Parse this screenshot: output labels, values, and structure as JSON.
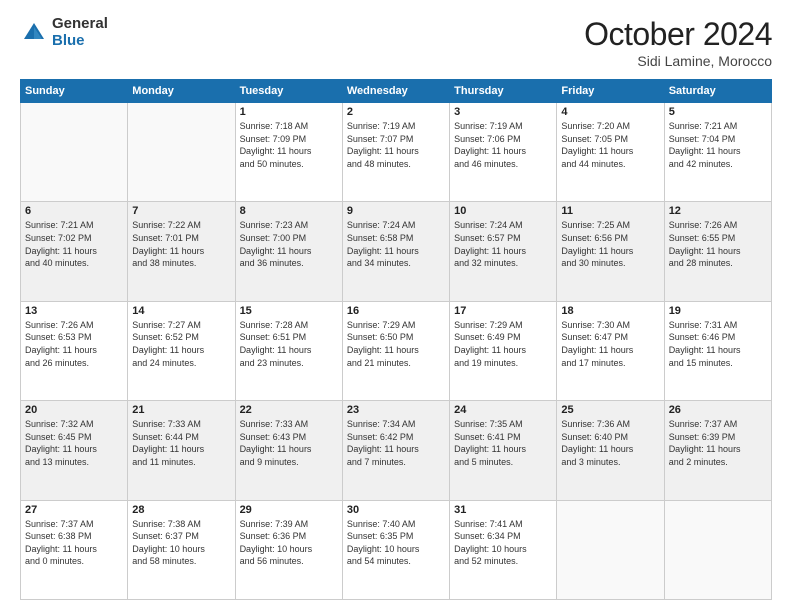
{
  "logo": {
    "general": "General",
    "blue": "Blue"
  },
  "title": {
    "month": "October 2024",
    "location": "Sidi Lamine, Morocco"
  },
  "headers": [
    "Sunday",
    "Monday",
    "Tuesday",
    "Wednesday",
    "Thursday",
    "Friday",
    "Saturday"
  ],
  "weeks": [
    [
      {
        "day": "",
        "info": ""
      },
      {
        "day": "",
        "info": ""
      },
      {
        "day": "1",
        "info": "Sunrise: 7:18 AM\nSunset: 7:09 PM\nDaylight: 11 hours\nand 50 minutes."
      },
      {
        "day": "2",
        "info": "Sunrise: 7:19 AM\nSunset: 7:07 PM\nDaylight: 11 hours\nand 48 minutes."
      },
      {
        "day": "3",
        "info": "Sunrise: 7:19 AM\nSunset: 7:06 PM\nDaylight: 11 hours\nand 46 minutes."
      },
      {
        "day": "4",
        "info": "Sunrise: 7:20 AM\nSunset: 7:05 PM\nDaylight: 11 hours\nand 44 minutes."
      },
      {
        "day": "5",
        "info": "Sunrise: 7:21 AM\nSunset: 7:04 PM\nDaylight: 11 hours\nand 42 minutes."
      }
    ],
    [
      {
        "day": "6",
        "info": "Sunrise: 7:21 AM\nSunset: 7:02 PM\nDaylight: 11 hours\nand 40 minutes."
      },
      {
        "day": "7",
        "info": "Sunrise: 7:22 AM\nSunset: 7:01 PM\nDaylight: 11 hours\nand 38 minutes."
      },
      {
        "day": "8",
        "info": "Sunrise: 7:23 AM\nSunset: 7:00 PM\nDaylight: 11 hours\nand 36 minutes."
      },
      {
        "day": "9",
        "info": "Sunrise: 7:24 AM\nSunset: 6:58 PM\nDaylight: 11 hours\nand 34 minutes."
      },
      {
        "day": "10",
        "info": "Sunrise: 7:24 AM\nSunset: 6:57 PM\nDaylight: 11 hours\nand 32 minutes."
      },
      {
        "day": "11",
        "info": "Sunrise: 7:25 AM\nSunset: 6:56 PM\nDaylight: 11 hours\nand 30 minutes."
      },
      {
        "day": "12",
        "info": "Sunrise: 7:26 AM\nSunset: 6:55 PM\nDaylight: 11 hours\nand 28 minutes."
      }
    ],
    [
      {
        "day": "13",
        "info": "Sunrise: 7:26 AM\nSunset: 6:53 PM\nDaylight: 11 hours\nand 26 minutes."
      },
      {
        "day": "14",
        "info": "Sunrise: 7:27 AM\nSunset: 6:52 PM\nDaylight: 11 hours\nand 24 minutes."
      },
      {
        "day": "15",
        "info": "Sunrise: 7:28 AM\nSunset: 6:51 PM\nDaylight: 11 hours\nand 23 minutes."
      },
      {
        "day": "16",
        "info": "Sunrise: 7:29 AM\nSunset: 6:50 PM\nDaylight: 11 hours\nand 21 minutes."
      },
      {
        "day": "17",
        "info": "Sunrise: 7:29 AM\nSunset: 6:49 PM\nDaylight: 11 hours\nand 19 minutes."
      },
      {
        "day": "18",
        "info": "Sunrise: 7:30 AM\nSunset: 6:47 PM\nDaylight: 11 hours\nand 17 minutes."
      },
      {
        "day": "19",
        "info": "Sunrise: 7:31 AM\nSunset: 6:46 PM\nDaylight: 11 hours\nand 15 minutes."
      }
    ],
    [
      {
        "day": "20",
        "info": "Sunrise: 7:32 AM\nSunset: 6:45 PM\nDaylight: 11 hours\nand 13 minutes."
      },
      {
        "day": "21",
        "info": "Sunrise: 7:33 AM\nSunset: 6:44 PM\nDaylight: 11 hours\nand 11 minutes."
      },
      {
        "day": "22",
        "info": "Sunrise: 7:33 AM\nSunset: 6:43 PM\nDaylight: 11 hours\nand 9 minutes."
      },
      {
        "day": "23",
        "info": "Sunrise: 7:34 AM\nSunset: 6:42 PM\nDaylight: 11 hours\nand 7 minutes."
      },
      {
        "day": "24",
        "info": "Sunrise: 7:35 AM\nSunset: 6:41 PM\nDaylight: 11 hours\nand 5 minutes."
      },
      {
        "day": "25",
        "info": "Sunrise: 7:36 AM\nSunset: 6:40 PM\nDaylight: 11 hours\nand 3 minutes."
      },
      {
        "day": "26",
        "info": "Sunrise: 7:37 AM\nSunset: 6:39 PM\nDaylight: 11 hours\nand 2 minutes."
      }
    ],
    [
      {
        "day": "27",
        "info": "Sunrise: 7:37 AM\nSunset: 6:38 PM\nDaylight: 11 hours\nand 0 minutes."
      },
      {
        "day": "28",
        "info": "Sunrise: 7:38 AM\nSunset: 6:37 PM\nDaylight: 10 hours\nand 58 minutes."
      },
      {
        "day": "29",
        "info": "Sunrise: 7:39 AM\nSunset: 6:36 PM\nDaylight: 10 hours\nand 56 minutes."
      },
      {
        "day": "30",
        "info": "Sunrise: 7:40 AM\nSunset: 6:35 PM\nDaylight: 10 hours\nand 54 minutes."
      },
      {
        "day": "31",
        "info": "Sunrise: 7:41 AM\nSunset: 6:34 PM\nDaylight: 10 hours\nand 52 minutes."
      },
      {
        "day": "",
        "info": ""
      },
      {
        "day": "",
        "info": ""
      }
    ]
  ]
}
